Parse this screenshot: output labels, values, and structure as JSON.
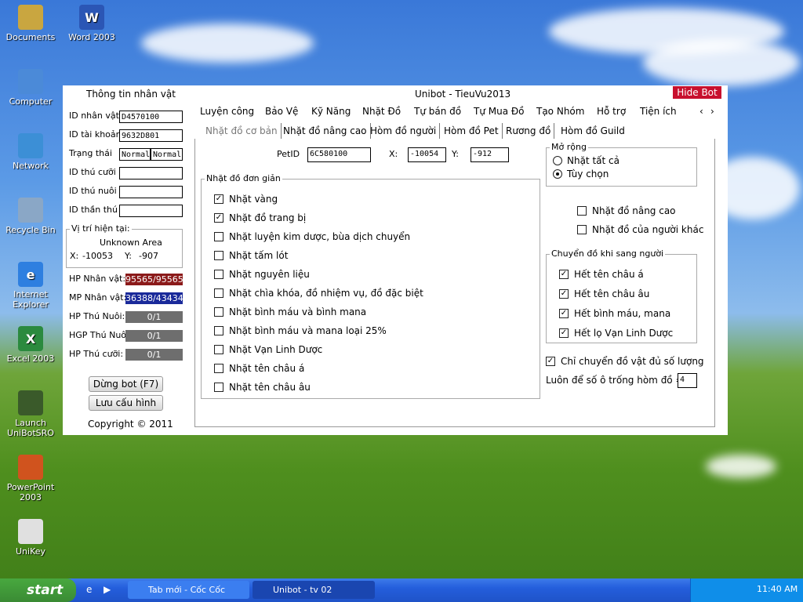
{
  "desktop": {
    "icons": [
      {
        "label": "Documents",
        "icon": "documents-icon",
        "color": "#c9a640"
      },
      {
        "label": "Word 2003",
        "icon": "word-icon",
        "color": "#2b56b5",
        "glyph": "W"
      },
      {
        "label": "Computer",
        "icon": "computer-icon",
        "color": "#4b8ad8"
      },
      {
        "label": "Network",
        "icon": "network-icon",
        "color": "#3c8fd6"
      },
      {
        "label": "Recycle Bin",
        "icon": "recycle-bin-icon",
        "color": "#8aa7c6"
      },
      {
        "label": "Internet Explorer",
        "icon": "internet-explorer-icon",
        "color": "#2e7fe0",
        "glyph": "e"
      },
      {
        "label": "Excel 2003",
        "icon": "excel-icon",
        "color": "#2b8a3e",
        "glyph": "X"
      },
      {
        "label": "Launch UniBotSRO",
        "icon": "unibot-icon",
        "color": "#3a5a2a"
      },
      {
        "label": "PowerPoint 2003",
        "icon": "powerpoint-icon",
        "color": "#d0531e"
      },
      {
        "label": "UniKey",
        "icon": "unikey-icon",
        "color": "#e0e0e0"
      }
    ]
  },
  "window": {
    "title": "Unibot - TieuVu2013",
    "hide_bot": "Hide Bot",
    "left_panel": {
      "title": "Thông tin nhân vật",
      "fields": [
        {
          "label": "ID nhân vật",
          "value": "D4570100"
        },
        {
          "label": "ID tài khoản",
          "value": "9632D801"
        },
        {
          "label": "Trạng thái",
          "value": "Normal",
          "value2": "Normal"
        },
        {
          "label": "ID thú cưỡi",
          "value": ""
        },
        {
          "label": "ID thú nuôi",
          "value": ""
        },
        {
          "label": "ID thần thú",
          "value": ""
        }
      ],
      "location": {
        "title": "Vị trí hiện tại:",
        "area": "Unknown Area",
        "x_label": "X:",
        "x": "-10053",
        "y_label": "Y:",
        "y": "-907"
      },
      "stats": [
        {
          "label": "HP Nhân vật:",
          "value": "95565/95565",
          "color": "#8b1a1a"
        },
        {
          "label": "MP Nhân vật:",
          "value": "36388/43434",
          "color": "#1a2a9a"
        },
        {
          "label": "HP Thú Nuôi:",
          "value": "0/1",
          "color": "#6e6e6e"
        },
        {
          "label": "HGP Thú Nuôi:",
          "value": "0/1",
          "color": "#6e6e6e"
        },
        {
          "label": "HP Thú cưỡi:",
          "value": "0/1",
          "color": "#6e6e6e"
        }
      ],
      "buttons": {
        "stop": "Dừng bot (F7)",
        "save": "Lưu cấu hình"
      },
      "copyright": "Copyright © 2011"
    },
    "menu": [
      "Luyện công",
      "Bảo Vệ",
      "Kỹ Năng",
      "Nhặt Đồ",
      "Tự bán đồ",
      "Tự Mua Đồ",
      "Tạo Nhóm",
      "Hỗ trợ",
      "Tiện ích"
    ],
    "tabs": [
      "Nhặt đồ cơ bản",
      "Nhặt đồ nâng cao",
      "Hòm đồ người",
      "Hòm đồ Pet",
      "Rương đồ",
      "Hòm đồ Guild"
    ],
    "pet": {
      "label": "PetID",
      "id": "6C580100",
      "x_label": "X:",
      "x": "-10054",
      "y_label": "Y:",
      "y": "-912"
    },
    "simple_pickup": {
      "title": "Nhặt đồ đơn giản",
      "items": [
        {
          "label": "Nhặt vàng",
          "checked": true
        },
        {
          "label": "Nhặt đồ trang bị",
          "checked": true
        },
        {
          "label": "Nhặt luyện kim dược, bùa dịch chuyển",
          "checked": false
        },
        {
          "label": "Nhặt tấm lót",
          "checked": false
        },
        {
          "label": "Nhặt nguyên liệu",
          "checked": false
        },
        {
          "label": "Nhặt chìa khóa, đồ nhiệm vụ,  đồ đặc biệt",
          "checked": false
        },
        {
          "label": "Nhặt bình máu và bình mana",
          "checked": false
        },
        {
          "label": "Nhặt bình máu và mana loại 25%",
          "checked": false
        },
        {
          "label": "Nhặt Vạn Linh Dược",
          "checked": false
        },
        {
          "label": "Nhặt tên châu á",
          "checked": false
        },
        {
          "label": "Nhặt tên châu âu",
          "checked": false
        }
      ]
    },
    "expand": {
      "title": "Mở rộng",
      "options": [
        {
          "label": "Nhặt tất cả",
          "selected": false
        },
        {
          "label": "Tùy chọn",
          "selected": true
        }
      ]
    },
    "extra": [
      {
        "label": "Nhặt đồ nâng cao",
        "checked": false
      },
      {
        "label": "Nhặt đồ của người khác",
        "checked": false
      }
    ],
    "transfer": {
      "title": "Chuyển đồ khi sang người",
      "items": [
        {
          "label": "Hết tên châu á",
          "checked": true
        },
        {
          "label": "Hết tên châu âu",
          "checked": true
        },
        {
          "label": "Hết bình máu, mana",
          "checked": true
        },
        {
          "label": "Hết lọ Vạn Linh Dược",
          "checked": true
        }
      ]
    },
    "only_enough": {
      "label": "Chỉ chuyển đồ vật đủ số lượng",
      "checked": true
    },
    "keep_slots": {
      "label": "Luôn để số ô trống  hòm đồ =",
      "value": "4"
    }
  },
  "taskbar": {
    "start": "start",
    "tasks": [
      {
        "label": "Tab mới - Cốc Cốc",
        "icon": "coccoc-icon"
      },
      {
        "label": "Unibot - tv 02",
        "icon": "unibot-task-icon"
      }
    ],
    "clock": "11:40 AM"
  }
}
